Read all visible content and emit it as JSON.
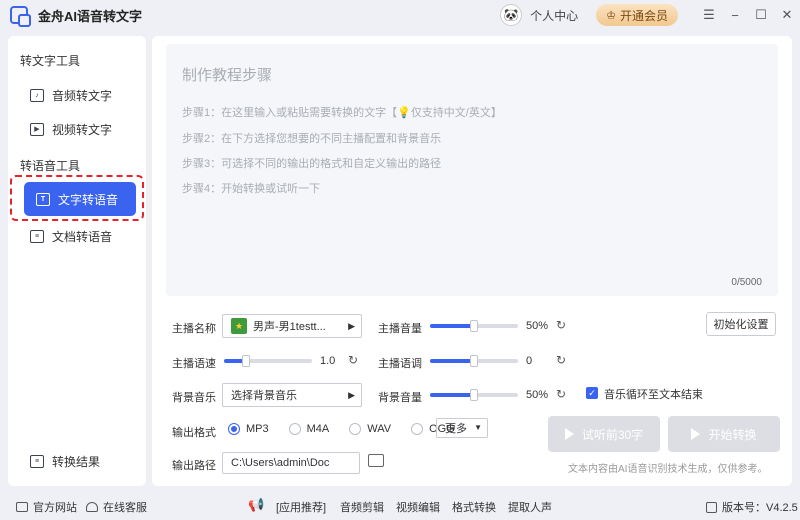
{
  "titlebar": {
    "app_title": "金舟AI语音转文字",
    "user_center": "个人中心",
    "vip_label": "开通会员",
    "menu_glyph": "☰",
    "min_glyph": "−",
    "max_glyph": "☐",
    "close_glyph": "✕"
  },
  "sidebar": {
    "group1_title": "转文字工具",
    "item_audio": "音频转文字",
    "item_video": "视频转文字",
    "group2_title": "转语音工具",
    "item_text_tts": "文字转语音",
    "item_doc_tts": "文档转语音",
    "item_results": "转换结果"
  },
  "editor": {
    "title": "制作教程步骤",
    "step1": "步骤1：在这里输入或粘贴需要转换的文字【💡仅支持中文/英文】",
    "step2": "步骤2：在下方选择您想要的不同主播配置和背景音乐",
    "step3": "步骤3：可选择不同的输出的格式和自定义输出的路径",
    "step4": "步骤4：开始转换或试听一下",
    "count": "0/5000"
  },
  "settings": {
    "anchor_label": "主播名称",
    "anchor_value": "男声-男1testt...",
    "anchor_volume_label": "主播音量",
    "anchor_volume_value": "50%",
    "anchor_volume_fraction": 0.5,
    "anchor_speed_label": "主播语速",
    "anchor_speed_value": "1.0",
    "anchor_speed_fraction": 0.25,
    "anchor_pitch_label": "主播语调",
    "anchor_pitch_value": "0",
    "anchor_pitch_fraction": 0.5,
    "bgm_label": "背景音乐",
    "bgm_value": "选择背景音乐",
    "bgm_volume_label": "背景音量",
    "bgm_volume_value": "50%",
    "bgm_volume_fraction": 0.5,
    "init_button": "初始化设置",
    "loop_label": "音乐循环至文本结束",
    "loop_checked": true,
    "format_label": "输出格式",
    "formats": [
      "MP3",
      "M4A",
      "WAV",
      "OGG"
    ],
    "format_selected": "MP3",
    "more_label": "更多",
    "path_label": "输出路径",
    "path_value": "C:\\Users\\admin\\Doc",
    "preview_button": "试听前30字",
    "start_button": "开始转换",
    "notice": "文本内容由AI语音识别技术生成，仅供参考。"
  },
  "footer": {
    "website": "官方网站",
    "support": "在线客服",
    "recommend": "[应用推荐]",
    "app1": "音频剪辑",
    "app2": "视频编辑",
    "app3": "格式转换",
    "app4": "提取人声",
    "version": "版本号：V4.2.5"
  },
  "colors": {
    "accent": "#3a64f0",
    "highlight_dash": "#e5232b",
    "vip_gold": "#f2c88f"
  }
}
